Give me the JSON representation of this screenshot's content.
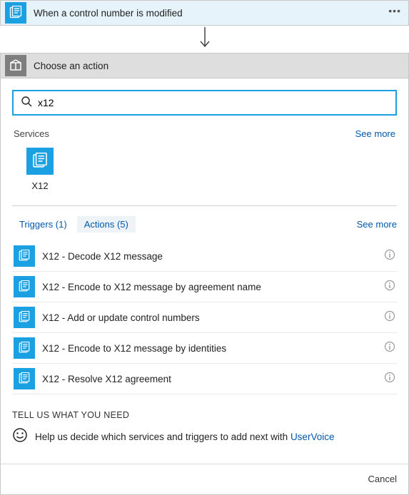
{
  "step": {
    "title": "When a control number is modified"
  },
  "choose": {
    "title": "Choose an action"
  },
  "search": {
    "value": "x12",
    "placeholder": ""
  },
  "services": {
    "label": "Services",
    "see_more": "See more",
    "items": [
      {
        "name": "X12"
      }
    ]
  },
  "tabs": {
    "triggers": "Triggers (1)",
    "actions": "Actions (5)",
    "see_more": "See more"
  },
  "actions": [
    {
      "label": "X12 - Decode X12 message"
    },
    {
      "label": "X12 - Encode to X12 message by agreement name"
    },
    {
      "label": "X12 - Add or update control numbers"
    },
    {
      "label": "X12 - Encode to X12 message by identities"
    },
    {
      "label": "X12 - Resolve X12 agreement"
    }
  ],
  "tell_us": {
    "heading": "TELL US WHAT YOU NEED",
    "text": "Help us decide which services and triggers to add next with ",
    "link": "UserVoice"
  },
  "footer": {
    "cancel": "Cancel"
  }
}
